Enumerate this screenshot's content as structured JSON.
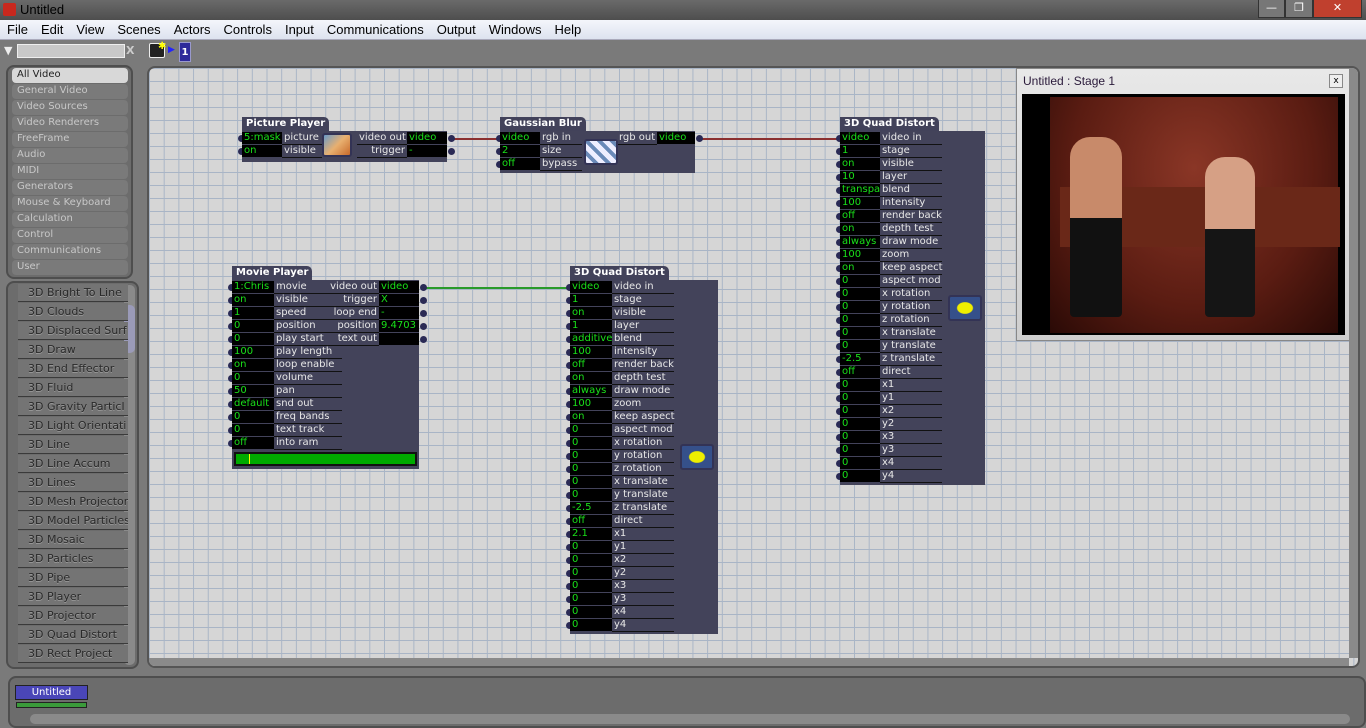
{
  "window": {
    "title": "Untitled",
    "minimize": "—",
    "restore": "❐",
    "close": "✕"
  },
  "menu": [
    "File",
    "Edit",
    "View",
    "Scenes",
    "Actors",
    "Controls",
    "Input",
    "Communications",
    "Output",
    "Windows",
    "Help"
  ],
  "toolbar": {
    "search_value": "",
    "clear_label": "X",
    "scene_number": "1"
  },
  "categories": [
    "All Video",
    "General Video",
    "Video Sources",
    "Video Renderers",
    "FreeFrame",
    "Audio",
    "MIDI",
    "Generators",
    "Mouse & Keyboard",
    "Calculation",
    "Control",
    "Communications",
    "User"
  ],
  "selected_category": "All Video",
  "actor_list": [
    "3D Bright To Line",
    "3D Clouds",
    "3D Displaced Surf",
    "3D Draw",
    "3D End Effector",
    "3D Fluid",
    "3D Gravity Particl",
    "3D Light Orientati",
    "3D Line",
    "3D Line Accum",
    "3D Lines",
    "3D Mesh Projector",
    "3D Model Particles",
    "3D Mosaic",
    "3D Particles",
    "3D Pipe",
    "3D Player",
    "3D Projector",
    "3D Quad Distort",
    "3D Rect Project"
  ],
  "actors": {
    "picture_player": {
      "title": "Picture Player",
      "inputs": [
        [
          "5:mask",
          "picture"
        ],
        [
          "on",
          "visible"
        ]
      ],
      "outputs": [
        [
          "video out",
          "video"
        ],
        [
          "trigger",
          "-"
        ]
      ]
    },
    "gaussian_blur": {
      "title": "Gaussian Blur",
      "inputs": [
        [
          "video",
          "rgb in"
        ],
        [
          "2",
          "size"
        ],
        [
          "off",
          "bypass"
        ]
      ],
      "outputs": [
        [
          "rgb out",
          "video"
        ]
      ]
    },
    "movie_player": {
      "title": "Movie Player",
      "inputs": [
        [
          "1:Chris",
          "movie"
        ],
        [
          "on",
          "visible"
        ],
        [
          "1",
          "speed"
        ],
        [
          "0",
          "position"
        ],
        [
          "0",
          "play start"
        ],
        [
          "100",
          "play length"
        ],
        [
          "on",
          "loop enable"
        ],
        [
          "0",
          "volume"
        ],
        [
          "50",
          "pan"
        ],
        [
          "default",
          "snd out"
        ],
        [
          "0",
          "freq bands"
        ],
        [
          "0",
          "text track"
        ],
        [
          "off",
          "into ram"
        ]
      ],
      "outputs": [
        [
          "video out",
          "video"
        ],
        [
          "trigger",
          "X"
        ],
        [
          "loop end",
          "-"
        ],
        [
          "position",
          "9.4703"
        ],
        [
          "text out",
          ""
        ]
      ],
      "progress": 0.07
    },
    "quad_distort_1": {
      "title": "3D Quad Distort",
      "inputs": [
        [
          "video",
          "video in"
        ],
        [
          "1",
          "stage"
        ],
        [
          "on",
          "visible"
        ],
        [
          "10",
          "layer"
        ],
        [
          "transpa",
          "blend"
        ],
        [
          "100",
          "intensity"
        ],
        [
          "off",
          "render back"
        ],
        [
          "on",
          "depth test"
        ],
        [
          "always",
          "draw mode"
        ],
        [
          "100",
          "zoom"
        ],
        [
          "on",
          "keep aspect"
        ],
        [
          "0",
          "aspect mod"
        ],
        [
          "0",
          "x rotation"
        ],
        [
          "0",
          "y rotation"
        ],
        [
          "0",
          "z rotation"
        ],
        [
          "0",
          "x translate"
        ],
        [
          "0",
          "y translate"
        ],
        [
          "-2.5",
          "z translate"
        ],
        [
          "off",
          "direct"
        ],
        [
          "0",
          "x1"
        ],
        [
          "0",
          "y1"
        ],
        [
          "0",
          "x2"
        ],
        [
          "0",
          "y2"
        ],
        [
          "0",
          "x3"
        ],
        [
          "0",
          "y3"
        ],
        [
          "0",
          "x4"
        ],
        [
          "0",
          "y4"
        ]
      ],
      "outputs": []
    },
    "quad_distort_2": {
      "title": "3D Quad Distort",
      "inputs": [
        [
          "video",
          "video in"
        ],
        [
          "1",
          "stage"
        ],
        [
          "on",
          "visible"
        ],
        [
          "1",
          "layer"
        ],
        [
          "additive",
          "blend"
        ],
        [
          "100",
          "intensity"
        ],
        [
          "off",
          "render back"
        ],
        [
          "on",
          "depth test"
        ],
        [
          "always",
          "draw mode"
        ],
        [
          "100",
          "zoom"
        ],
        [
          "on",
          "keep aspect"
        ],
        [
          "0",
          "aspect mod"
        ],
        [
          "0",
          "x rotation"
        ],
        [
          "0",
          "y rotation"
        ],
        [
          "0",
          "z rotation"
        ],
        [
          "0",
          "x translate"
        ],
        [
          "0",
          "y translate"
        ],
        [
          "-2.5",
          "z translate"
        ],
        [
          "off",
          "direct"
        ],
        [
          "2.1",
          "x1"
        ],
        [
          "0",
          "y1"
        ],
        [
          "0",
          "x2"
        ],
        [
          "0",
          "y2"
        ],
        [
          "0",
          "x3"
        ],
        [
          "0",
          "y3"
        ],
        [
          "0",
          "x4"
        ],
        [
          "0",
          "y4"
        ]
      ],
      "outputs": []
    }
  },
  "stage_window": {
    "title": "Untitled : Stage 1",
    "close": "x"
  },
  "bottom": {
    "scene_tab": "Untitled"
  },
  "colors": {
    "wire_video": "#8b3030",
    "wire_movie": "#2a9a2a",
    "value_text": "#19e019",
    "actor_body": "#43435a",
    "scene_tab": "#4a46b8"
  }
}
